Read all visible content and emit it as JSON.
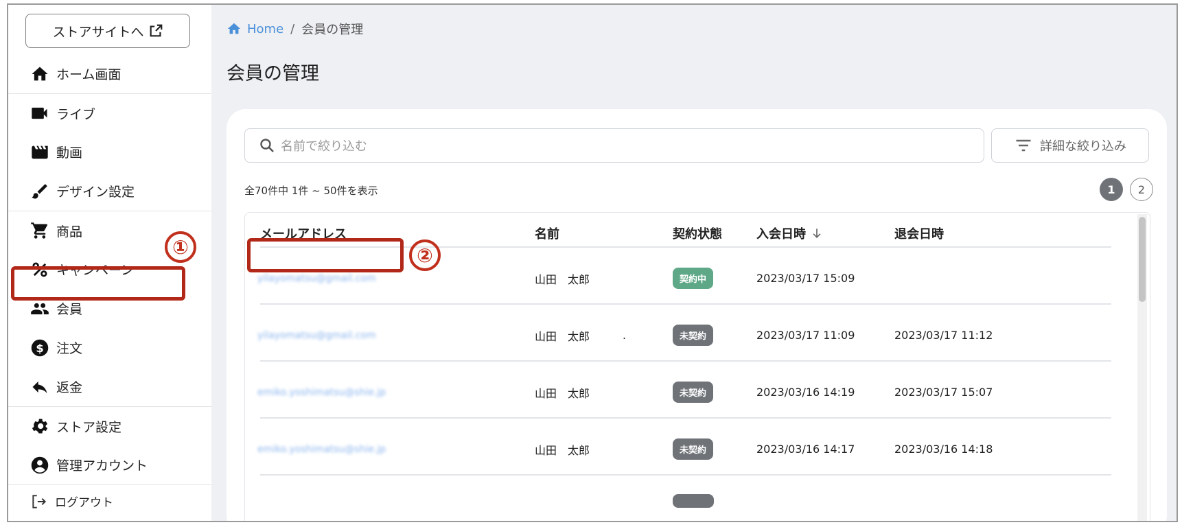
{
  "sidebar": {
    "store_button": "ストアサイトへ",
    "items": [
      {
        "label": "ホーム画面",
        "icon": "home-icon"
      },
      {
        "label": "ライブ",
        "icon": "video-camera-icon"
      },
      {
        "label": "動画",
        "icon": "movie-icon"
      },
      {
        "label": "デザイン設定",
        "icon": "brush-icon"
      },
      {
        "label": "商品",
        "icon": "cart-icon"
      },
      {
        "label": "キャンペーン",
        "icon": "percent-icon"
      },
      {
        "label": "会員",
        "icon": "people-icon"
      },
      {
        "label": "注文",
        "icon": "dollar-icon"
      },
      {
        "label": "返金",
        "icon": "reply-icon"
      },
      {
        "label": "ストア設定",
        "icon": "gear-icon"
      },
      {
        "label": "管理アカウント",
        "icon": "account-circle-icon"
      },
      {
        "label": "ログアウト",
        "icon": "logout-icon"
      }
    ]
  },
  "annotations": {
    "step1": "①",
    "step2": "②"
  },
  "breadcrumb": {
    "home": "Home",
    "separator": "/",
    "current": "会員の管理"
  },
  "page_title": "会員の管理",
  "search": {
    "placeholder": "名前で絞り込む"
  },
  "filter_button": "詳細な絞り込み",
  "summary": "全70件中 1件 ~ 50件を表示",
  "pagination": {
    "pages": [
      "1",
      "2"
    ],
    "current": "1"
  },
  "table": {
    "headers": {
      "email": "メールアドレス",
      "name": "名前",
      "status": "契約状態",
      "joined": "入会日時",
      "left": "退会日時"
    },
    "rows": [
      {
        "email": "yilayomatsu@gmail.com",
        "name": "山田　太郎",
        "status": "契約中",
        "joined": "2023/03/17 15:09",
        "left": ""
      },
      {
        "email": "yilayomatsu@gmail.com",
        "name": "山田　太郎",
        "extra": ".",
        "status": "未契約",
        "joined": "2023/03/17 11:09",
        "left": "2023/03/17 11:12"
      },
      {
        "email": "emiko.yoshimatsu@shie.jp",
        "name": "山田　太郎",
        "status": "未契約",
        "joined": "2023/03/16 14:19",
        "left": "2023/03/17 15:07"
      },
      {
        "email": "emiko.yoshimatsu@shie.jp",
        "name": "山田　太郎",
        "status": "未契約",
        "joined": "2023/03/16 14:17",
        "left": "2023/03/16 14:18"
      }
    ]
  },
  "colors": {
    "accent": "#4a90d9",
    "annotation": "#b22818",
    "badge_active": "#5fa887",
    "badge_inactive": "#6f7378",
    "background": "#eef0f4"
  }
}
